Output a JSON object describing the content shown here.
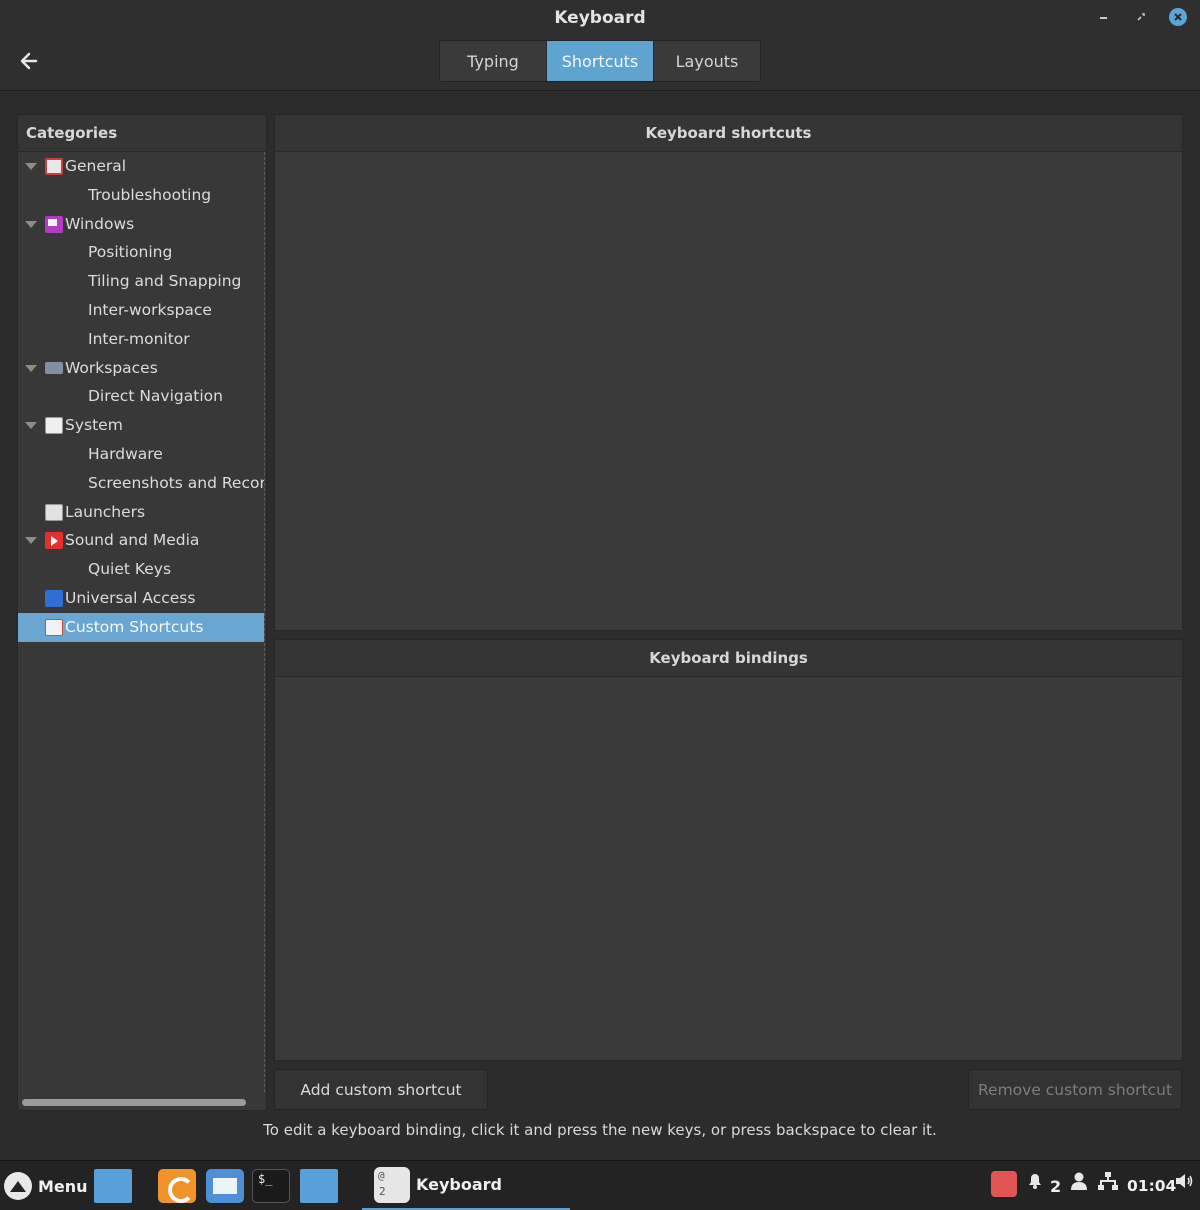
{
  "window": {
    "title": "Keyboard"
  },
  "tabs": [
    {
      "label": "Typing",
      "active": false
    },
    {
      "label": "Shortcuts",
      "active": true
    },
    {
      "label": "Layouts",
      "active": false
    }
  ],
  "categories": {
    "header": "Categories",
    "items": [
      {
        "label": "General",
        "level": "top",
        "expanded": true,
        "icon": "general-icon"
      },
      {
        "label": "Troubleshooting",
        "level": "sub"
      },
      {
        "label": "Windows",
        "level": "top",
        "expanded": true,
        "icon": "windows-icon"
      },
      {
        "label": "Positioning",
        "level": "sub"
      },
      {
        "label": "Tiling and Snapping",
        "level": "sub"
      },
      {
        "label": "Inter-workspace",
        "level": "sub"
      },
      {
        "label": "Inter-monitor",
        "level": "sub"
      },
      {
        "label": "Workspaces",
        "level": "top",
        "expanded": true,
        "icon": "workspaces-icon"
      },
      {
        "label": "Direct Navigation",
        "level": "sub"
      },
      {
        "label": "System",
        "level": "top",
        "expanded": true,
        "icon": "system-icon"
      },
      {
        "label": "Hardware",
        "level": "sub"
      },
      {
        "label": "Screenshots and Recordir",
        "level": "sub"
      },
      {
        "label": "Launchers",
        "level": "top",
        "expanded": false,
        "icon": "launchers-icon"
      },
      {
        "label": "Sound and Media",
        "level": "top",
        "expanded": true,
        "icon": "sound-media-icon"
      },
      {
        "label": "Quiet Keys",
        "level": "sub"
      },
      {
        "label": "Universal Access",
        "level": "top",
        "expanded": false,
        "icon": "universal-access-icon"
      },
      {
        "label": "Custom Shortcuts",
        "level": "top",
        "expanded": false,
        "icon": "custom-shortcuts-icon",
        "selected": true
      }
    ]
  },
  "shortcuts_panel": {
    "header": "Keyboard shortcuts"
  },
  "bindings_panel": {
    "header": "Keyboard bindings"
  },
  "buttons": {
    "add": "Add custom shortcut",
    "remove": "Remove custom shortcut"
  },
  "hint": "To edit a keyboard binding, click it and press the new keys, or press backspace to clear it.",
  "taskbar": {
    "menu_label": "Menu",
    "active_task": "Keyboard",
    "task_icon_top": "@",
    "task_icon_bottom": "2",
    "notification_count": "2",
    "clock": "01:04"
  },
  "colors": {
    "accent": "#5fa3d0",
    "selected": "#6aa6d2",
    "background": "#2c2c2c"
  }
}
